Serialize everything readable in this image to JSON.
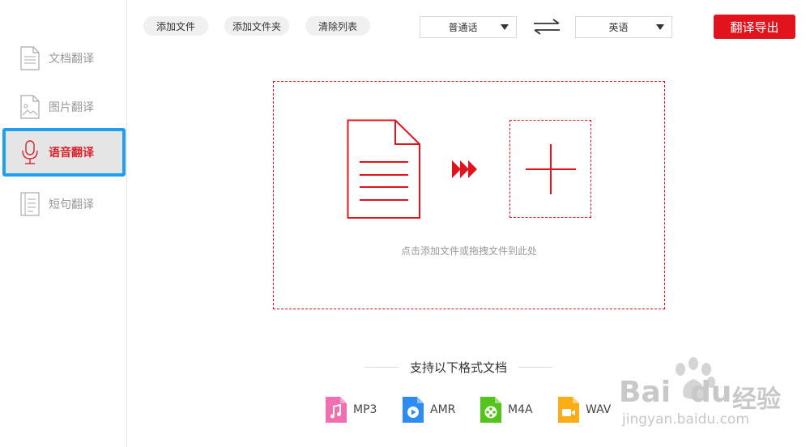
{
  "sidebar": {
    "items": [
      {
        "label": "文档翻译",
        "icon": "document-icon"
      },
      {
        "label": "图片翻译",
        "icon": "image-icon"
      },
      {
        "label": "语音翻译",
        "icon": "microphone-icon"
      },
      {
        "label": "短句翻译",
        "icon": "sentence-icon"
      }
    ],
    "active_index": 2
  },
  "toolbar": {
    "add_file": "添加文件",
    "add_folder": "添加文件夹",
    "clear_list": "清除列表",
    "source_lang": "普通话",
    "target_lang": "英语",
    "export": "翻译导出"
  },
  "dropzone": {
    "hint": "点击添加文件或拖拽文件到此处"
  },
  "formats": {
    "title": "支持以下格式文档",
    "items": [
      {
        "label": "MP3",
        "color": "#f06fb1"
      },
      {
        "label": "AMR",
        "color": "#2d8cf0"
      },
      {
        "label": "M4A",
        "color": "#52c41a"
      },
      {
        "label": "WAV",
        "color": "#faad14"
      }
    ]
  },
  "watermark": {
    "brand": "Bai",
    "brand2": "du",
    "brand_cn": "经验",
    "url": "jingyan.baidu.com"
  },
  "colors": {
    "accent": "#e1141d",
    "selection_border": "#1ea0f0"
  }
}
